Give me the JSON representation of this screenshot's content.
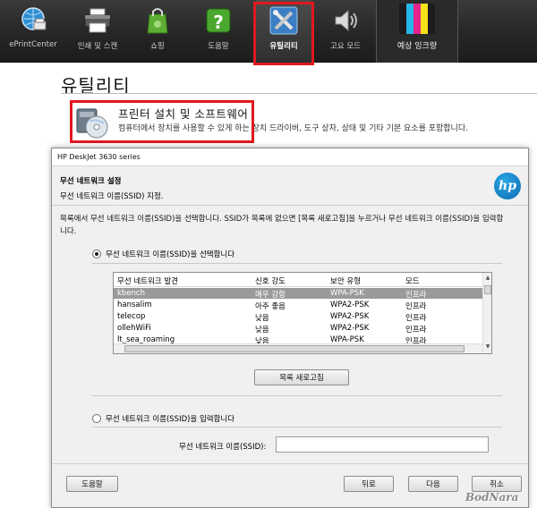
{
  "toolbar": {
    "items": [
      {
        "label": "ePrintCenter",
        "icon": "globe-printer-icon"
      },
      {
        "label": "인쇄 및 스캔",
        "icon": "printer-icon"
      },
      {
        "label": "쇼핑",
        "icon": "shopping-bag-icon"
      },
      {
        "label": "도움말",
        "icon": "help-icon"
      },
      {
        "label": "유틸리티",
        "icon": "tools-icon",
        "selected": true
      },
      {
        "label": "고요 모드",
        "icon": "speaker-icon"
      }
    ],
    "ink_label": "예상 잉크량",
    "ink_colors": [
      "#1c1c1c",
      "#26b6e8",
      "#e4238c",
      "#f4e21b",
      "#1c1c1c"
    ]
  },
  "page": {
    "title": "유틸리티",
    "option": {
      "name": "프린터 설치 및 소프트웨어",
      "description": "컴퓨터에서 장치를 사용할 수 있게 하는 장치 드라이버, 도구 상자, 상태 및 기타 기본 요소를 포함합니다."
    }
  },
  "dialog": {
    "window_title": "HP DeskJet 3630 series",
    "header_title": "무선 네트워크 설정",
    "header_subtitle": "무선 네트워크 이름(SSID) 지정.",
    "logo_text": "hp",
    "instruction": "목록에서 무선 네트워크 이름(SSID)을 선택합니다. SSID가 목록에 없으면 [목록 새로고침]을 누르거나 무선 네트워크 이름(SSID)을 입력합니다.",
    "radio_select_label": "무선 네트워크 이름(SSID)을 선택합니다",
    "radio_enter_label": "무선 네트워크 이름(SSID)을 입력합니다",
    "table": {
      "headers": [
        "무선 네트워크 발견",
        "신호 강도",
        "보안 유형",
        "모드"
      ],
      "rows": [
        [
          "kbench",
          "매우 강함",
          "WPA-PSK",
          "인프라"
        ],
        [
          "hansalim",
          "아주 좋음",
          "WPA2-PSK",
          "인프라"
        ],
        [
          "telecop",
          "낮음",
          "WPA2-PSK",
          "인프라"
        ],
        [
          "ollehWiFi",
          "낮음",
          "WPA2-PSK",
          "인프라"
        ],
        [
          "lt_sea_roaming",
          "낮음",
          "WPA-PSK",
          "인프라"
        ]
      ]
    },
    "refresh_button": "목록 새로고침",
    "ssid_label": "무선 네트워크 이름(SSID):",
    "ssid_value": "",
    "buttons": {
      "help": "도움말",
      "back": "뒤로",
      "next": "다음",
      "cancel": "취소"
    }
  },
  "watermark": "BodNara"
}
